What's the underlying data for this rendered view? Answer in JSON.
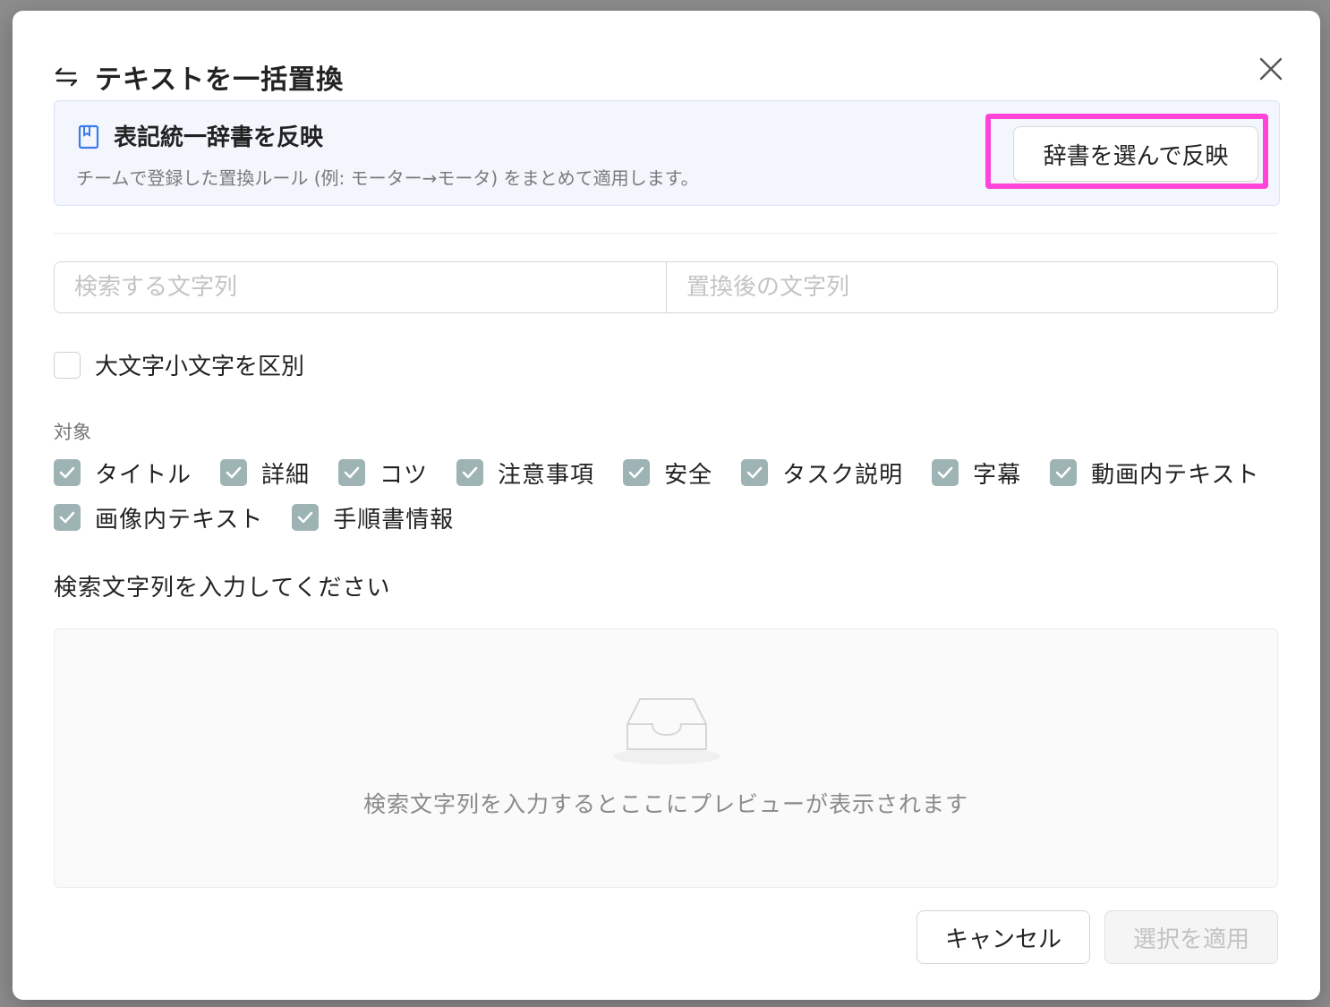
{
  "dialog": {
    "title": "テキストを一括置換",
    "close_label": "×"
  },
  "dictionary": {
    "title": "表記統一辞書を反映",
    "description": "チームで登録した置換ルール (例: モーター→モータ) をまとめて適用します。",
    "button_label": "辞書を選んで反映",
    "highlight_color": "#ff44d7"
  },
  "search": {
    "search_placeholder": "検索する文字列",
    "search_value": "",
    "replace_placeholder": "置換後の文字列",
    "replace_value": ""
  },
  "options": {
    "case_sensitive_label": "大文字小文字を区別",
    "case_sensitive_checked": false
  },
  "targets": {
    "label": "対象",
    "items": [
      {
        "label": "タイトル",
        "checked": true
      },
      {
        "label": "詳細",
        "checked": true
      },
      {
        "label": "コツ",
        "checked": true
      },
      {
        "label": "注意事項",
        "checked": true
      },
      {
        "label": "安全",
        "checked": true
      },
      {
        "label": "タスク説明",
        "checked": true
      },
      {
        "label": "字幕",
        "checked": true
      },
      {
        "label": "動画内テキスト",
        "checked": true
      },
      {
        "label": "画像内テキスト",
        "checked": true
      },
      {
        "label": "手順書情報",
        "checked": true
      }
    ]
  },
  "status": {
    "hint": "検索文字列を入力してください"
  },
  "preview": {
    "empty_text": "検索文字列を入力するとここにプレビューが表示されます"
  },
  "footer": {
    "cancel_label": "キャンセル",
    "apply_label": "選択を適用",
    "apply_disabled": true
  },
  "colors": {
    "checkbox_checked": "#9eb3b4",
    "dict_box_bg": "#f3f6fd"
  }
}
